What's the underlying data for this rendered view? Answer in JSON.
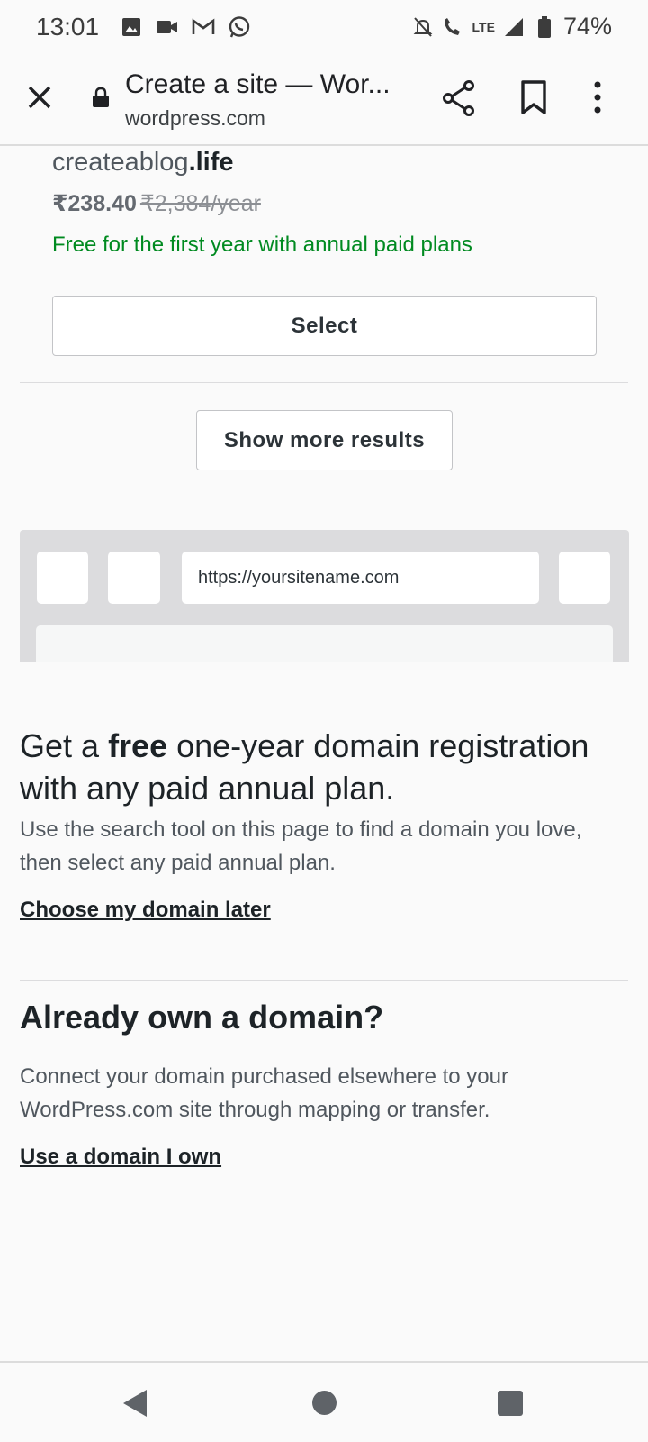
{
  "status_bar": {
    "time": "13:01",
    "left_icons": [
      "image-icon",
      "video-icon",
      "gmail-icon",
      "whatsapp-icon"
    ],
    "right_icons": [
      "mute-icon",
      "volte-call-icon",
      "lte-signal-icon",
      "battery-icon"
    ],
    "lte_label": "LTE",
    "battery": "74%"
  },
  "browser": {
    "title": "Create a site — Wor...",
    "url": "wordpress.com"
  },
  "domain_result": {
    "name_prefix": "createablog",
    "name_tld": ".life",
    "sale_price": "₹238.40",
    "original_price": "₹2,384/year",
    "free_note": "Free for the first year with annual paid plans",
    "select_label": "Select"
  },
  "show_more_label": "Show more results",
  "illustration": {
    "url_text": "https://yoursitename.com"
  },
  "promo": {
    "heading_pre": "Get a ",
    "heading_bold": "free",
    "heading_post": " one-year domain registration with any paid annual plan.",
    "body": "Use the search tool on this page to find a domain you love, then select any paid annual plan.",
    "link": "Choose my domain later"
  },
  "own_domain": {
    "heading": "Already own a domain?",
    "body": "Connect your domain purchased elsewhere to your WordPress.com site through mapping or transfer.",
    "link": "Use a domain I own"
  },
  "colors": {
    "green": "#008a20",
    "text_dark": "#1d2327",
    "text_muted": "#50575e"
  }
}
